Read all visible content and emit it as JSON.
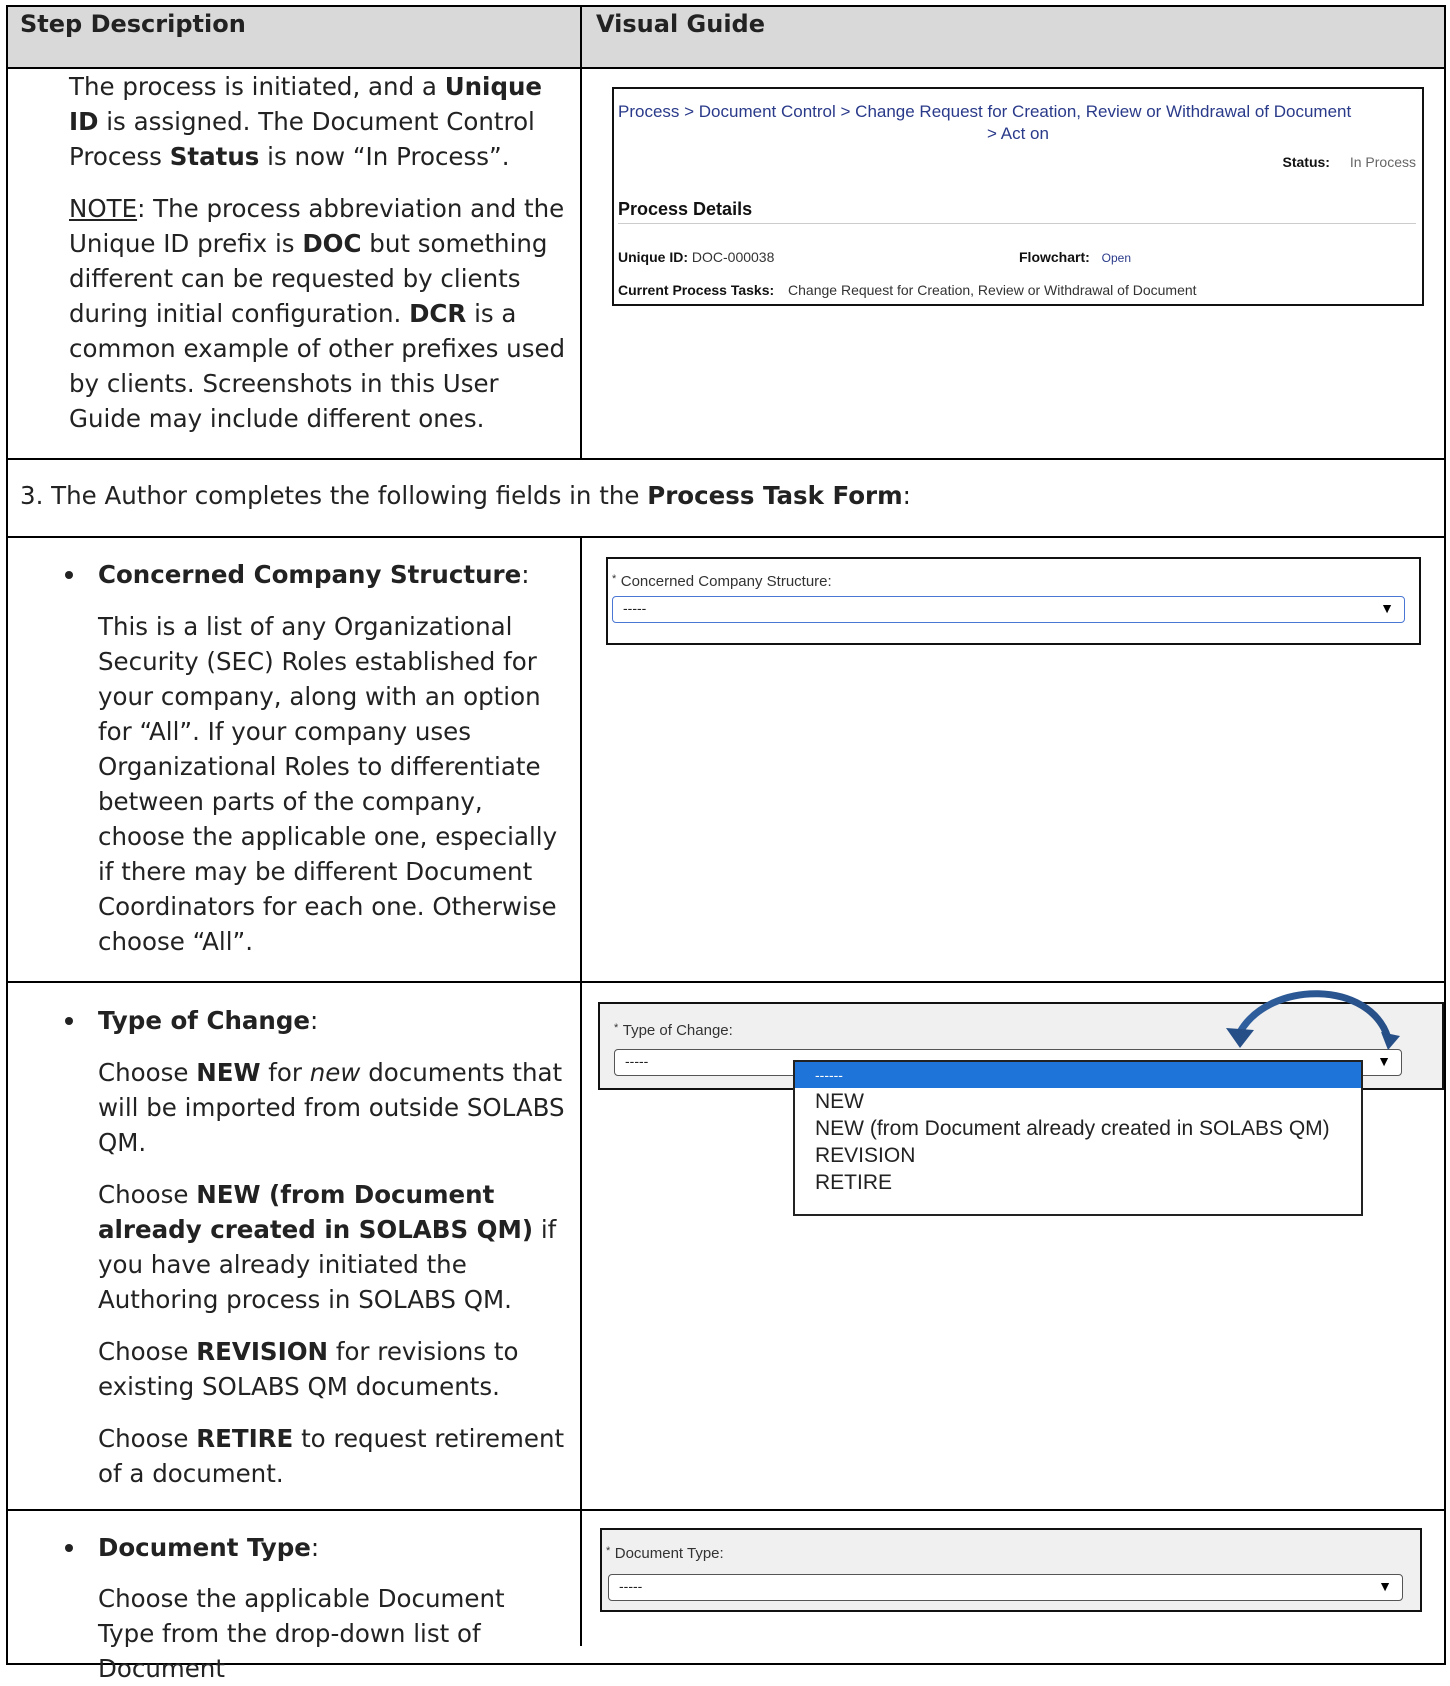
{
  "header": {
    "col1": "Step Description",
    "col2": "Visual Guide"
  },
  "row1": {
    "para1_pre": "The process is initiated, and a ",
    "para1_b1": "Unique ID",
    "para1_mid": " is assigned.  The Document Control Process ",
    "para1_b2": "Status",
    "para1_post": " is now “In Process”.",
    "note_label": "NOTE",
    "note_pre": ": The process abbreviation and the Unique ID prefix is ",
    "note_b1": "DOC",
    "note_mid": " but something different can be requested by clients during initial configuration.   ",
    "note_b2": "DCR",
    "note_post": " is a common example of other prefixes used by clients.  Screenshots in this User Guide may include different ones.",
    "shot": {
      "breadcrumb_line1": "Process > Document Control > Change Request for Creation, Review or Withdrawal of Document",
      "breadcrumb_line2": "> Act on",
      "status_label": "Status:",
      "status_value": "In Process",
      "section_title": "Process Details",
      "uid_label": "Unique ID:",
      "uid_value": "DOC-000038",
      "flow_label": "Flowchart:",
      "flow_value": "Open",
      "tasks_label": "Current Process Tasks:",
      "tasks_value": "Change Request for Creation, Review or Withdrawal of Document"
    }
  },
  "row2": {
    "pre": "3.  The Author completes the following fields in the ",
    "b": "Process Task Form",
    "post": ":"
  },
  "row3": {
    "title": "Concerned Company Structure",
    "title_colon": ":",
    "desc": "This is a list of any Organizational Security (SEC) Roles established for your company, along with an option for “All”.   If your company uses Organizational Roles to differentiate between parts of the company, choose the applicable one, especially if there may be different Document Coordinators for each one.  Otherwise choose “All”.",
    "shot": {
      "star": "*",
      "label": "Concerned Company Structure:",
      "value": "-----",
      "caret": "▼"
    }
  },
  "row4": {
    "title": "Type of Change",
    "title_colon": ":",
    "p1_pre": "Choose ",
    "p1_b": "NEW",
    "p1_mid": " for ",
    "p1_i": "new",
    "p1_post": " documents that will be imported from outside SOLABS QM.",
    "p2_pre": "Choose ",
    "p2_b": "NEW (from Document already created in SOLABS QM)",
    "p2_post": " if you have already initiated the Authoring process in SOLABS QM.",
    "p3_pre": "Choose ",
    "p3_b": "REVISION",
    "p3_post": " for revisions to existing SOLABS QM documents.",
    "p4_pre": "Choose ",
    "p4_b": "RETIRE",
    "p4_post": " to request retirement of a document.",
    "shot": {
      "star": "*",
      "label": "Type of Change:",
      "value": "-----",
      "caret": "▼",
      "options": [
        "------",
        "NEW",
        "NEW (from Document already created in SOLABS QM)",
        "REVISION",
        "RETIRE"
      ]
    }
  },
  "row5": {
    "title": "Document Type",
    "title_colon": ":",
    "desc": "Choose the applicable Document Type from the drop-down list of Document",
    "shot": {
      "star": "*",
      "label": "Document Type:",
      "value": "-----",
      "caret": "▼"
    }
  }
}
